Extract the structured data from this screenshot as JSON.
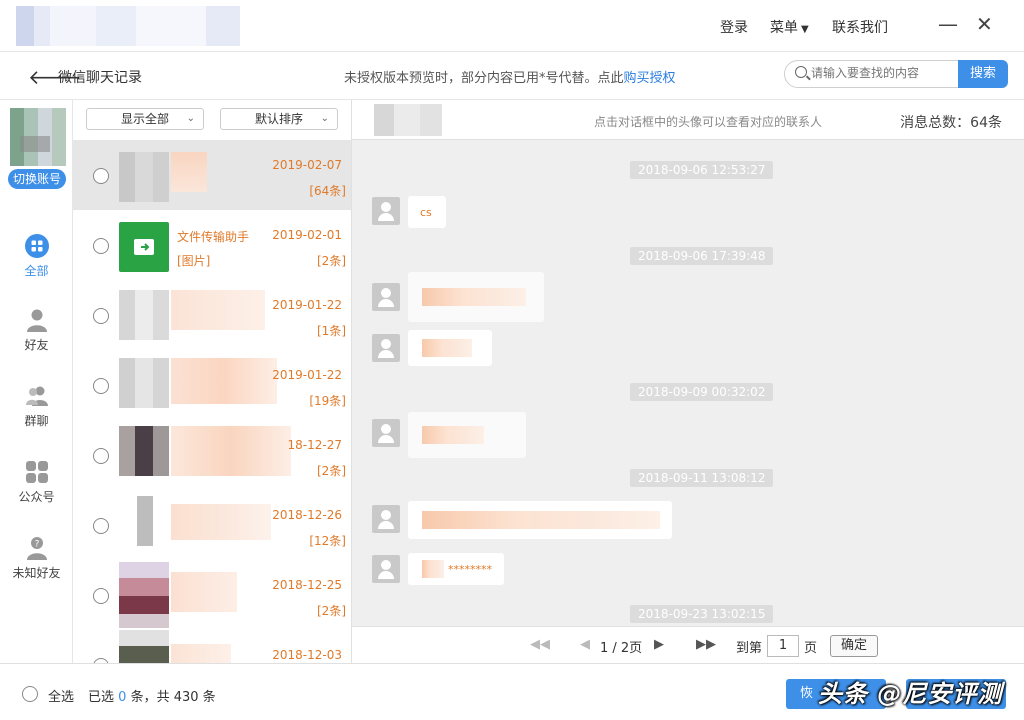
{
  "header": {
    "login": "登录",
    "menu": "菜单",
    "contact": "联系我们"
  },
  "subbar": {
    "title": "微信聊天记录",
    "notice": "未授权版本预览时，部分内容已用*号代替。点此",
    "notice_link": "购买授权",
    "search_placeholder": "请输入要查找的内容",
    "search_button": "搜索"
  },
  "sidebar": {
    "switch_account": "切换账号",
    "items": [
      {
        "label": "全部",
        "icon": "grid-icon"
      },
      {
        "label": "好友",
        "icon": "person-icon"
      },
      {
        "label": "群聊",
        "icon": "group-icon"
      },
      {
        "label": "公众号",
        "icon": "apps-icon"
      },
      {
        "label": "未知好友",
        "icon": "unknown-person-icon"
      }
    ]
  },
  "list": {
    "filter": "显示全部",
    "sort": "默认排序",
    "rows": [
      {
        "name": "",
        "preview": "",
        "date": "2019-02-07",
        "count": "[64条]"
      },
      {
        "name": "文件传输助手",
        "preview": "[图片]",
        "date": "2019-02-01",
        "count": "[2条]"
      },
      {
        "name": "",
        "preview": "",
        "date": "2019-01-22",
        "count": "[1条]"
      },
      {
        "name": "",
        "preview": "",
        "date": "2019-01-22",
        "count": "[19条]"
      },
      {
        "name": "",
        "preview": "",
        "date": "18-12-27",
        "count": "[2条]"
      },
      {
        "name": "",
        "preview": "",
        "date": "2018-12-26",
        "count": "[12条]"
      },
      {
        "name": "",
        "preview": "",
        "date": "2018-12-25",
        "count": "[2条]"
      },
      {
        "name": "",
        "preview": "",
        "date": "2018-12-03",
        "count": ""
      }
    ]
  },
  "chat": {
    "hint": "点击对话框中的头像可以查看对应的联系人",
    "total_label": "消息总数：64条",
    "timestamps": [
      "2018-09-06 12:53:27",
      "2018-09-06 17:39:48",
      "2018-09-09 00:32:02",
      "2018-09-11 13:08:12",
      "2018-09-23 13:02:15"
    ],
    "messages": [
      {
        "text": "cs"
      },
      {
        "text": ""
      },
      {
        "text": ""
      },
      {
        "text": ""
      },
      {
        "text": ""
      },
      {
        "text": "********"
      }
    ],
    "pager": {
      "page": "1 / 2页",
      "goto": "到第",
      "input": "1",
      "unit": "页",
      "confirm": "确定"
    }
  },
  "footer": {
    "select_all": "全选",
    "selected_prefix": "已选",
    "selected_count": "0",
    "selected_suffix": "条，共 430 条",
    "recover_label": "恢",
    "watermark": "头条 @尼安评测"
  }
}
